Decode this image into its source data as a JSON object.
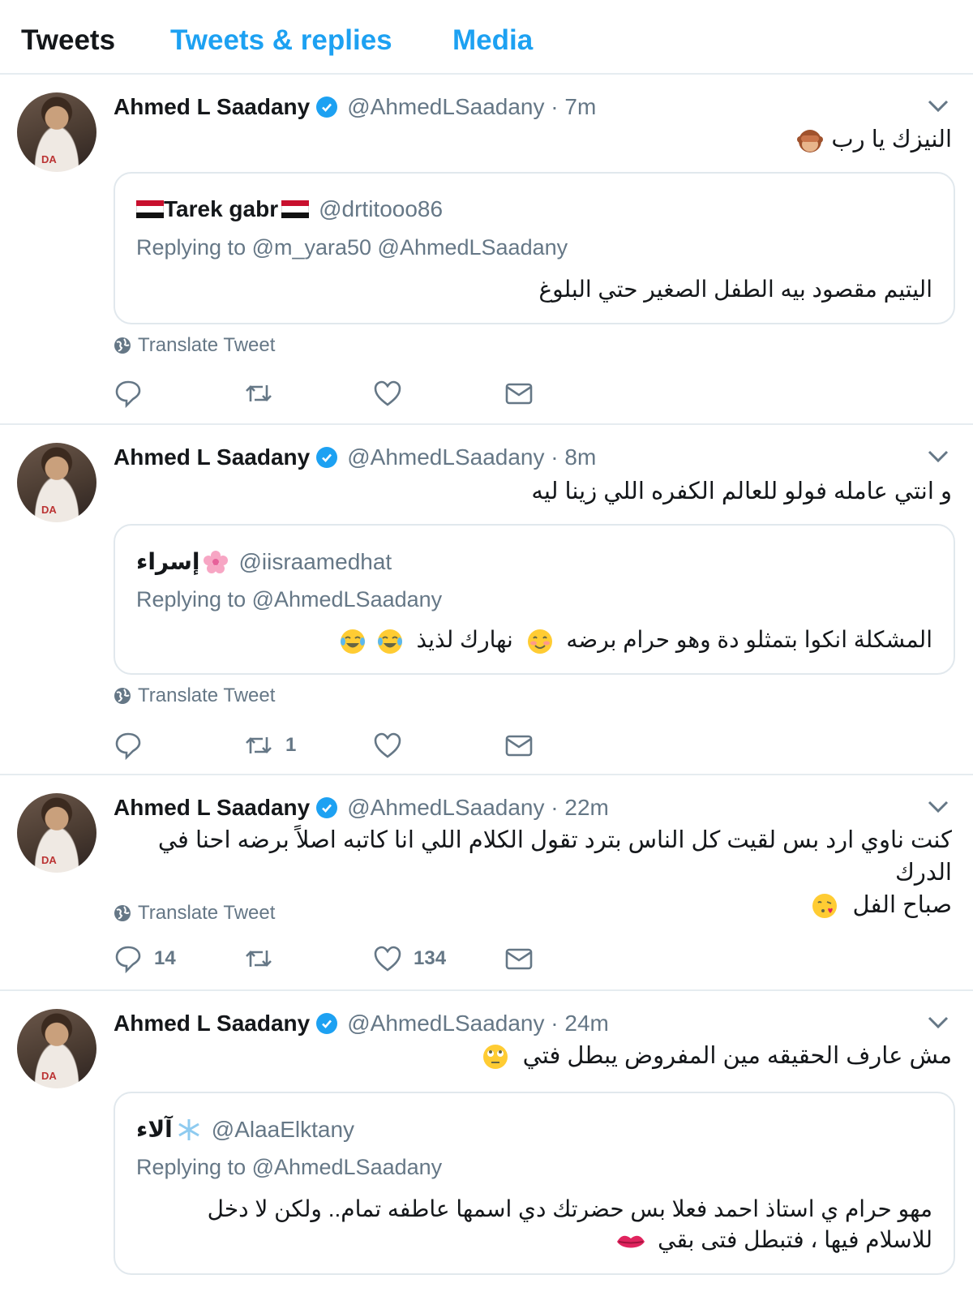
{
  "tabs": {
    "tweets": "Tweets",
    "replies": "Tweets & replies",
    "media": "Media"
  },
  "colors": {
    "accent": "#1da1f2",
    "muted": "#657786",
    "text": "#14171a",
    "divider": "#e6ecf0"
  },
  "translate_label": "Translate Tweet",
  "tweets": [
    {
      "name": "Ahmed L Saadany",
      "handle_time": "@AhmedLSaadany · 7m",
      "lines": [
        "النيزك يا رب"
      ],
      "quote": {
        "name": "Tarek gabr",
        "handle": "@drtitooo86",
        "replying": "Replying to @m_yara50 @AhmedLSaadany",
        "lines": [
          "اليتيم مقصود بيه الطفل الصغير حتي البلوغ"
        ]
      },
      "counts": {
        "reply": "",
        "retweet": "",
        "like": ""
      }
    },
    {
      "name": "Ahmed L Saadany",
      "handle_time": "@AhmedLSaadany · 8m",
      "lines": [
        "و انتي عامله فولو للعالم الكفره اللي زينا ليه"
      ],
      "quote": {
        "name": "إسراء",
        "handle": "@iisraamedhat",
        "replying": "Replying to @AhmedLSaadany",
        "lines": [
          "المشكلة انكوا بتمثلو دة وهو حرام برضه",
          "نهارك لذيذ"
        ]
      },
      "counts": {
        "reply": "",
        "retweet": "1",
        "like": ""
      }
    },
    {
      "name": "Ahmed L Saadany",
      "handle_time": "@AhmedLSaadany · 22m",
      "lines": [
        "كنت ناوي ارد بس لقيت كل الناس بترد تقول الكلام اللي انا كاتبه اصلاً برضه احنا في الدرك",
        "صباح الفل"
      ],
      "counts": {
        "reply": "14",
        "retweet": "",
        "like": "134"
      }
    },
    {
      "name": "Ahmed L Saadany",
      "handle_time": "@AhmedLSaadany · 24m",
      "lines": [
        "مش عارف الحقيقه مين المفروض يبطل فتي"
      ],
      "quote": {
        "name": "آلاء",
        "handle": "@AlaaElktany",
        "replying": "Replying to @AhmedLSaadany",
        "lines": [
          "مهو حرام ي استاذ  احمد فعلا بس حضرتك دي اسمها عاطفه  تمام.. ولكن لا دخل",
          "للاسلام فيها ، فتبطل فتى بقي"
        ]
      }
    }
  ]
}
